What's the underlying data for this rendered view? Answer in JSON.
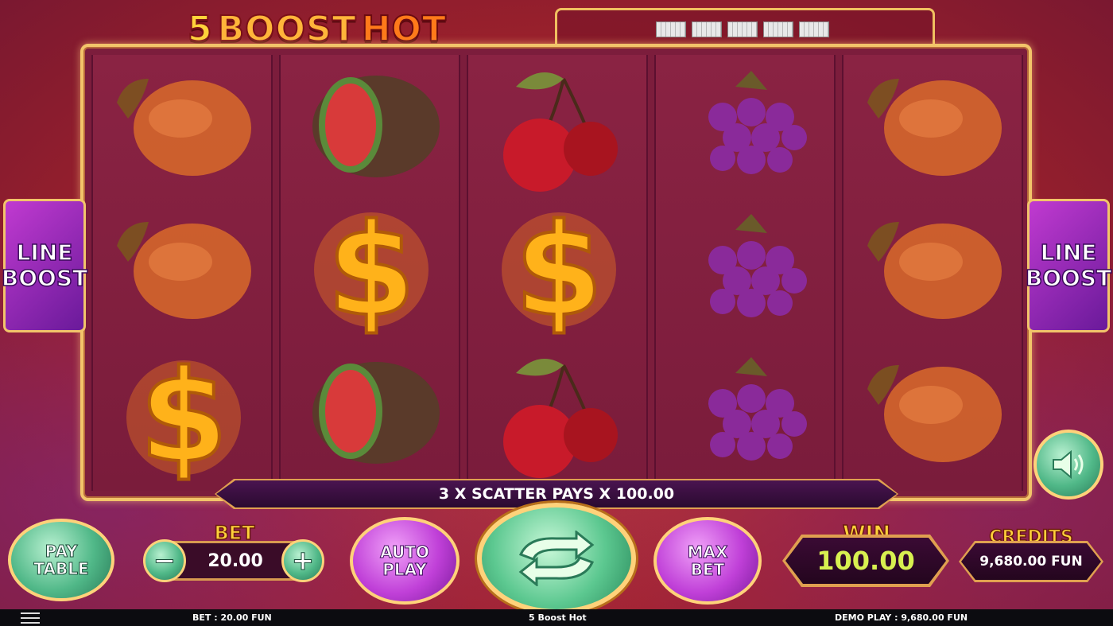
{
  "game": {
    "title_parts": [
      "5",
      "BOOST",
      "HOT"
    ],
    "line_boost_left": [
      "LINE",
      "BOOST"
    ],
    "line_boost_right": [
      "LINE",
      "BOOST"
    ],
    "message": "3 X SCATTER PAYS X 100.00"
  },
  "reels": [
    [
      "lemon",
      "lemon",
      "dollar-scatter"
    ],
    [
      "watermelon",
      "dollar-scatter",
      "watermelon"
    ],
    [
      "cherry",
      "dollar-scatter",
      "cherry"
    ],
    [
      "grapes",
      "grapes",
      "grapes"
    ],
    [
      "lemon",
      "lemon",
      "lemon"
    ]
  ],
  "controls": {
    "pay_table": [
      "PAY",
      "TABLE"
    ],
    "bet_label": "BET",
    "bet_value": "20.00",
    "minus": "−",
    "plus": "+",
    "auto_play": [
      "AUTO",
      "PLAY"
    ],
    "max_bet": [
      "MAX",
      "BET"
    ],
    "win_label": "WIN",
    "win_value": "100.00",
    "credits_label": "CREDITS",
    "credits_value": "9,680.00 FUN"
  },
  "status_bar": {
    "bet": "BET : 20.00 FUN",
    "title": "5 Boost Hot",
    "balance": "DEMO PLAY : 9,680.00 FUN"
  },
  "colors": {
    "frame_gold": "#f2c46a",
    "reel_bg": "#7c1d3c",
    "win_value": "#d8f050",
    "label_gold": "#ffd23a"
  }
}
